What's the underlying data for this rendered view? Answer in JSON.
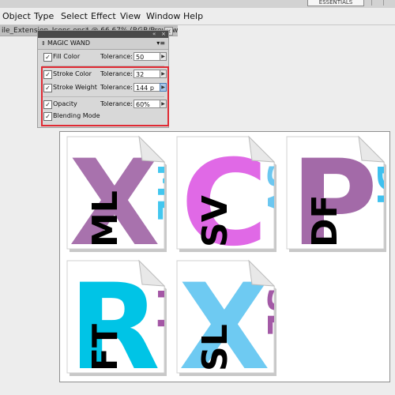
{
  "toolbar": {
    "workspace_label": "ESSENTIALS"
  },
  "menu": [
    "Object",
    "Type",
    "Select",
    "Effect",
    "View",
    "Window",
    "Help"
  ],
  "document_tab": {
    "label": "ile_Extension_Icons.eps* @ 66.67% (RGB/Preview)"
  },
  "panel": {
    "title": "MAGIC WAND",
    "tolerance_label": "Tolerance:",
    "options": [
      {
        "label": "Fill Color",
        "checked": true,
        "tolerance": "50"
      },
      {
        "label": "Stroke Color",
        "checked": true,
        "tolerance": "32"
      },
      {
        "label": "Stroke Weight",
        "checked": true,
        "tolerance": "144 p"
      },
      {
        "label": "Opacity",
        "checked": true,
        "tolerance": "60%"
      },
      {
        "label": "Blending Mode",
        "checked": true
      }
    ]
  },
  "highlight_color": "#e02a33",
  "icons": [
    {
      "name": "XML",
      "big": "X",
      "small": "ML",
      "big_color": "#a872ad",
      "small_color": "#43c7ef"
    },
    {
      "name": "CSV",
      "big": "C",
      "small": "SV",
      "big_color": "#e069e6",
      "small_color": "#6cc7f0"
    },
    {
      "name": "PDF",
      "big": "P",
      "small": "DF",
      "big_color": "#a36aa8",
      "small_color": "#3fc1ef"
    },
    {
      "name": "RTF",
      "big": "R",
      "small": "FT",
      "big_color": "#00c4e6",
      "small_color": "#a457a5"
    },
    {
      "name": "XSL",
      "big": "X",
      "small": "SL",
      "big_color": "#6ecaf2",
      "small_color": "#a35aa6"
    }
  ]
}
